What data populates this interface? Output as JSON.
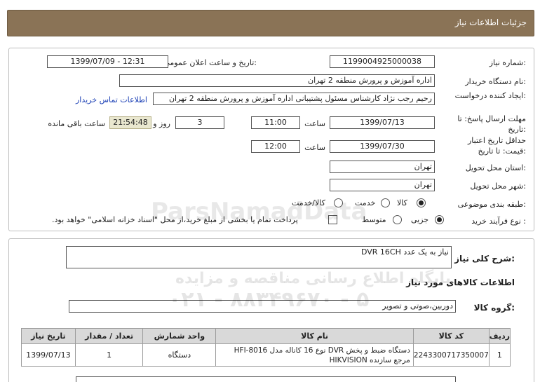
{
  "header": {
    "title": "جزئیات اطلاعات نیاز"
  },
  "form": {
    "need_number_label": "شماره نیاز:",
    "need_number": "1199004925000038",
    "announce_label": "تاریخ و ساعت اعلان عمومی:",
    "announce_value": "1399/07/09 - 12:31",
    "buyer_label": "نام دستگاه خریدار:",
    "buyer_value": "اداره آموزش و پرورش منطقه 2 تهران",
    "creator_label": "ایجاد کننده درخواست:",
    "creator_value": "رحیم رجب نژاد کارشناس مسئول پشتیبانی اداره آموزش و پرورش منطقه 2 تهران",
    "contact_link": "اطلاعات تماس خریدار",
    "deadline_label": "مهلت ارسال پاسخ: تا تاریخ:",
    "deadline_date": "1399/07/13",
    "time_label": "ساعت",
    "deadline_time": "11:00",
    "days_value": "3",
    "days_label": "روز و",
    "remaining_time": "21:54:48",
    "remaining_label": "ساعت باقی مانده",
    "validity_label": "حداقل تاریخ اعتبار قیمت: تا تاریخ:",
    "validity_date": "1399/07/30",
    "validity_time_label": "ساعت",
    "validity_time": "12:00",
    "province_label": "استان محل تحویل:",
    "province_value": "تهران",
    "city_label": "شهر محل تحویل:",
    "city_value": "تهران",
    "category_label": "طبقه بندی موضوعی:",
    "category_options": [
      "کالا",
      "خدمت",
      "کالا/خدمت"
    ],
    "purchase_label": "نوع فرآیند خرید :",
    "purchase_options": [
      "جزیی",
      "متوسط"
    ],
    "payment_note": "پرداخت تمام یا بخشی از مبلغ خرید،از محل \"اسناد خزانه اسلامی\" خواهد بود."
  },
  "details": {
    "summary_label": "شرح کلی نیاز:",
    "summary_value": "نیاز به یک عدد DVR 16CH",
    "goods_section": "اطلاعات کالاهای مورد نیاز",
    "group_label": "گروه کالا:",
    "group_value": "دوربین،صوتی و تصویر"
  },
  "table": {
    "headers": [
      "ردیف",
      "کد کالا",
      "نام کالا",
      "واحد شمارش",
      "تعداد / مقدار",
      "تاریخ نیاز"
    ],
    "rows": [
      [
        "1",
        "2243300717350007",
        "دستگاه ضبط و پخش DVR نوع 16 کاناله مدل HFI-8016 مرجع سازنده HIKVISION",
        "دستگاه",
        "1",
        "1399/07/13"
      ]
    ]
  },
  "watermark": {
    "line1": "ParsNamadData",
    "line2": "پایگاه اطلاع رسانی مناقصه و مزایده",
    "line3": "۰۲۱ - ۸۸۳۴۹۶۷۰ - ۵"
  }
}
